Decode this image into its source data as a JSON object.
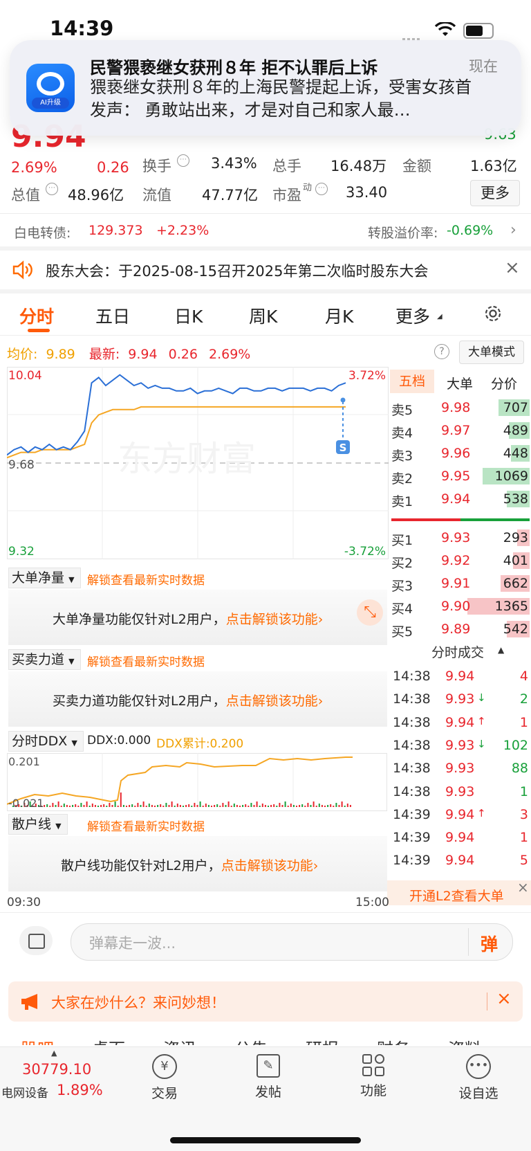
{
  "status_bar": {
    "time": "14:39"
  },
  "notification": {
    "title": "民警猥亵继女获刑８年 拒不认罪后上诉",
    "time": "现在",
    "body": "猥亵继女获刑８年的上海民警提起上诉，受害女孩首发声： 勇敢站出来，才是对自己和家人最…",
    "app_badge": "AI升级"
  },
  "quote": {
    "price": "9.94",
    "change_pct": "2.69%",
    "change": "0.26",
    "top_right_value": "9.63",
    "turnover_label": "换手",
    "turnover": "3.43%",
    "volume_label": "总手",
    "volume": "16.48万",
    "amount_label": "金额",
    "amount": "1.63亿",
    "mktcap_label": "总值",
    "mktcap": "48.96亿",
    "float_label": "流值",
    "float": "47.77亿",
    "pe_label": "市盈",
    "pe_sup": "动",
    "pe": "33.40",
    "more": "更多"
  },
  "bond": {
    "label": "白电转债:",
    "price": "129.373",
    "change": "+2.23%",
    "premium_label": "转股溢价率:",
    "premium": "-0.69%"
  },
  "announcement": {
    "text": "股东大会：于2025-08-15召开2025年第二次临时股东大会"
  },
  "tabs": [
    "分时",
    "五日",
    "日K",
    "周K",
    "月K",
    "更多"
  ],
  "summary": {
    "avg_label": "均价:",
    "avg": "9.89",
    "last_label": "最新:",
    "last": "9.94",
    "chg": "0.26",
    "pct": "2.69%",
    "mode_btn": "大单模式"
  },
  "chart": {
    "y_top": "10.04",
    "y_mid": "9.68",
    "y_bottom": "9.32",
    "pct_top": "3.72%",
    "pct_bottom": "-3.72%",
    "watermark": "东方财富",
    "marker": "S",
    "time_start": "09:30",
    "time_end": "15:00"
  },
  "chart_data": {
    "type": "line",
    "ylim": [
      9.32,
      10.04
    ],
    "prev_close": 9.68,
    "series": [
      {
        "name": "最新",
        "values": [
          9.71,
          9.73,
          9.74,
          9.72,
          9.74,
          9.73,
          9.75,
          9.73,
          9.74,
          9.73,
          9.76,
          9.8,
          9.98,
          10.0,
          9.97,
          9.99,
          10.01,
          9.99,
          9.97,
          9.98,
          9.96,
          9.97,
          9.96,
          9.96,
          9.95,
          9.95,
          9.96,
          9.94,
          9.95,
          9.95,
          9.96,
          9.95,
          9.94,
          9.96,
          9.96,
          9.95,
          9.95,
          9.96,
          9.96,
          9.95,
          9.96,
          9.96,
          9.96,
          9.95,
          9.96,
          9.96,
          9.95,
          9.97,
          9.98
        ]
      },
      {
        "name": "均价",
        "values": [
          9.7,
          9.71,
          9.72,
          9.72,
          9.72,
          9.73,
          9.73,
          9.73,
          9.73,
          9.73,
          9.74,
          9.75,
          9.83,
          9.86,
          9.87,
          9.88,
          9.88,
          9.88,
          9.88,
          9.89,
          9.89,
          9.89,
          9.89,
          9.89,
          9.89,
          9.89,
          9.89,
          9.89,
          9.89,
          9.89,
          9.89,
          9.89,
          9.89,
          9.89,
          9.89,
          9.89,
          9.89,
          9.89,
          9.89,
          9.89,
          9.89,
          9.89,
          9.89,
          9.89,
          9.89,
          9.89,
          9.89,
          9.89,
          9.89
        ]
      }
    ]
  },
  "order_book": {
    "tabs": [
      "五档",
      "大单",
      "分价"
    ],
    "asks": [
      {
        "label": "卖5",
        "price": "9.98",
        "vol": "707",
        "bar": 0.3
      },
      {
        "label": "卖4",
        "price": "9.97",
        "vol": "489",
        "bar": 0.2
      },
      {
        "label": "卖3",
        "price": "9.96",
        "vol": "448",
        "bar": 0.18
      },
      {
        "label": "卖2",
        "price": "9.95",
        "vol": "1069",
        "bar": 0.45
      },
      {
        "label": "卖1",
        "price": "9.94",
        "vol": "538",
        "bar": 0.22
      }
    ],
    "bids": [
      {
        "label": "买1",
        "price": "9.93",
        "vol": "293",
        "bar": 0.12
      },
      {
        "label": "买2",
        "price": "9.92",
        "vol": "401",
        "bar": 0.16
      },
      {
        "label": "买3",
        "price": "9.91",
        "vol": "662",
        "bar": 0.28
      },
      {
        "label": "买4",
        "price": "9.90",
        "vol": "1365",
        "bar": 0.6
      },
      {
        "label": "买5",
        "price": "9.89",
        "vol": "542",
        "bar": 0.22
      }
    ]
  },
  "ticks": {
    "title": "分时成交",
    "rows": [
      {
        "time": "14:38",
        "price": "9.94",
        "arrow": "",
        "vol": "4",
        "vol_color": "red"
      },
      {
        "time": "14:38",
        "price": "9.93",
        "arrow": "↓",
        "vol": "2",
        "vol_color": "green"
      },
      {
        "time": "14:38",
        "price": "9.94",
        "arrow": "↑",
        "vol": "1",
        "vol_color": "red"
      },
      {
        "time": "14:38",
        "price": "9.93",
        "arrow": "↓",
        "vol": "102",
        "vol_color": "green"
      },
      {
        "time": "14:38",
        "price": "9.93",
        "arrow": "",
        "vol": "88",
        "vol_color": "green"
      },
      {
        "time": "14:38",
        "price": "9.93",
        "arrow": "",
        "vol": "1",
        "vol_color": "green"
      },
      {
        "time": "14:39",
        "price": "9.94",
        "arrow": "↑",
        "vol": "3",
        "vol_color": "red"
      },
      {
        "time": "14:39",
        "price": "9.94",
        "arrow": "",
        "vol": "1",
        "vol_color": "red"
      },
      {
        "time": "14:39",
        "price": "9.94",
        "arrow": "",
        "vol": "5",
        "vol_color": "red"
      }
    ],
    "l2_banner": "开通L2查看大单"
  },
  "panels": {
    "big_order": {
      "dropdown": "大单净量",
      "unlock_hint": "解锁查看最新实时数据",
      "msg": "大单净量功能仅针对L2用户，",
      "link": "点击解锁该功能"
    },
    "force": {
      "dropdown": "买卖力道",
      "unlock_hint": "解锁查看最新实时数据",
      "msg": "买卖力道功能仅针对L2用户，",
      "link": "点击解锁该功能"
    },
    "ddx": {
      "dropdown": "分时DDX",
      "ddx_label": "DDX:0.000",
      "ddx_cum": "DDX累计:0.200",
      "y_top": "0.201",
      "y_bottom": "-0.021"
    },
    "retail": {
      "dropdown": "散户线",
      "unlock_hint": "解锁查看最新实时数据",
      "msg": "散户线功能仅针对L2用户，",
      "link": "点击解锁该功能"
    }
  },
  "comment": {
    "placeholder": "弹幕走一波...",
    "danmu": "弹"
  },
  "ask_banner": {
    "text": "大家在炒什么？来问妙想！"
  },
  "bottom_tabs_partial": [
    "股吧",
    "桌面",
    "资讯",
    "公告",
    "研报",
    "财务",
    "资料"
  ],
  "bottom_bar": {
    "index_value": "30779.10",
    "index_name": "电网设备",
    "index_pct": "1.89%",
    "items": [
      {
        "label": "交易",
        "icon": "yen-icon"
      },
      {
        "label": "发帖",
        "icon": "edit-icon"
      },
      {
        "label": "功能",
        "icon": "grid-icon"
      },
      {
        "label": "设自选",
        "icon": "more-icon"
      }
    ]
  }
}
